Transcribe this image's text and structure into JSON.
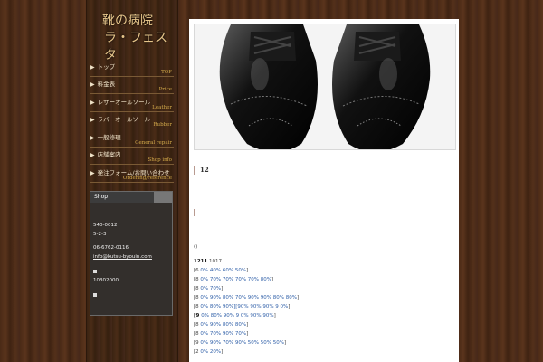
{
  "logo": {
    "line1": "靴の病院",
    "line2": "ラ・フェスタ"
  },
  "nav": [
    {
      "jp": "トップ",
      "en": "TOP"
    },
    {
      "jp": "料金表",
      "en": "Price"
    },
    {
      "jp": "レザーオールソール",
      "en": "Leather"
    },
    {
      "jp": "ラバーオールソール",
      "en": "Rubber"
    },
    {
      "jp": "一般修理",
      "en": "General repair"
    },
    {
      "jp": "店舗案内",
      "en": "Shop info"
    },
    {
      "jp": "発注フォーム/お問い合わせ",
      "en": "Ordering/reference"
    }
  ],
  "nav_arrow": "▶",
  "shop": {
    "title": "Shop",
    "postal": "540-0012",
    "address": "5-2-3",
    "phone": "06-6762-0116",
    "email": "info@kutsu-byouin.com",
    "number": "10302000"
  },
  "main": {
    "heading": "12",
    "paren": "()",
    "summary_bold": "1211",
    "summary_rest": " 1017",
    "rows": [
      {
        "prefix": "[6  ",
        "values": "0% 40% 60% 50%",
        "suffix": "]"
      },
      {
        "prefix": "[8  ",
        "values": "0% 70% 70% 70% 70% 80%",
        "suffix": "]"
      },
      {
        "prefix": "[8  ",
        "values": "0% 70%",
        "suffix": "]"
      },
      {
        "prefix": "[8  ",
        "values": "0% 90% 80% 70% 90% 90% 80% 80%",
        "suffix": "]"
      },
      {
        "prefix": "[8  ",
        "values": "0% 80% 90%][90% 90% 90% 9  0%",
        "suffix": "]"
      },
      {
        "prefix": "[9  ",
        "values": "0% 80% 90% 9  0% 90% 90%",
        "suffix": "]",
        "bold_prefix": true
      },
      {
        "prefix": "[8  ",
        "values": "0% 90% 80% 80%",
        "suffix": "]"
      },
      {
        "prefix": "[8  ",
        "values": "0% 70% 90% 70%",
        "suffix": "]"
      },
      {
        "prefix": "[9  ",
        "values": "0% 90% 70% 90% 50% 50% 50%",
        "suffix": "]"
      },
      {
        "prefix": "[2  ",
        "values": "0% 20%",
        "suffix": "]"
      }
    ]
  }
}
